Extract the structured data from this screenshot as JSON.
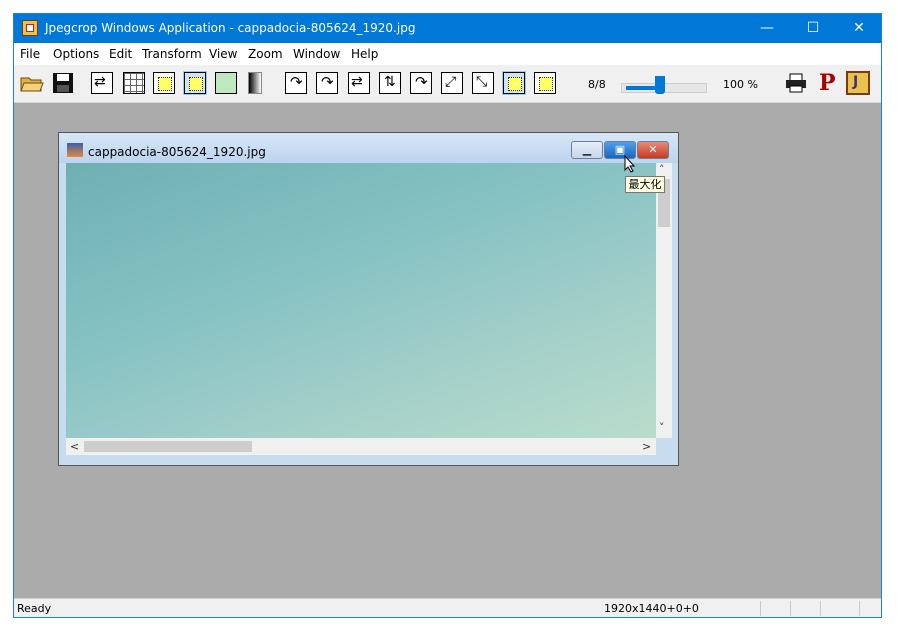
{
  "app": {
    "title": "Jpegcrop Windows Application - cappadocia-805624_1920.jpg",
    "icon": "jpegcrop-app-icon",
    "caption_buttons": {
      "minimize": "—",
      "maximize": "☐",
      "close": "✕"
    }
  },
  "menu": [
    "File",
    "Options",
    "Edit",
    "Transform",
    "View",
    "Zoom",
    "Window",
    "Help"
  ],
  "toolbar": {
    "buttons": [
      "open-folder-icon",
      "save-disk-icon",
      "transform-icon",
      "grid-icon",
      "crop-select-icon",
      "crop-fit-icon",
      "crop-frame-icon",
      "gradient-icon",
      "rotate-left-icon",
      "rotate-right-icon",
      "flip-horizontal-icon",
      "flip-vertical-icon",
      "rotate-90-icon",
      "transpose-icon",
      "transverse-icon",
      "select-all-icon",
      "select-none-icon"
    ],
    "page_count": "8/8",
    "zoom_slider_fraction": 0.45,
    "zoom_text": "100 %",
    "accent": "#0078d7"
  },
  "document": {
    "title": "cappadocia-805624_1920.jpg",
    "tooltip": "最大化"
  },
  "status": {
    "left": "Ready",
    "dimensions": "1920x1440+0+0"
  },
  "colors": {
    "titlebar": "#0078d7",
    "workspace": "#ababab",
    "tooltip_bg": "#ffffe1"
  }
}
